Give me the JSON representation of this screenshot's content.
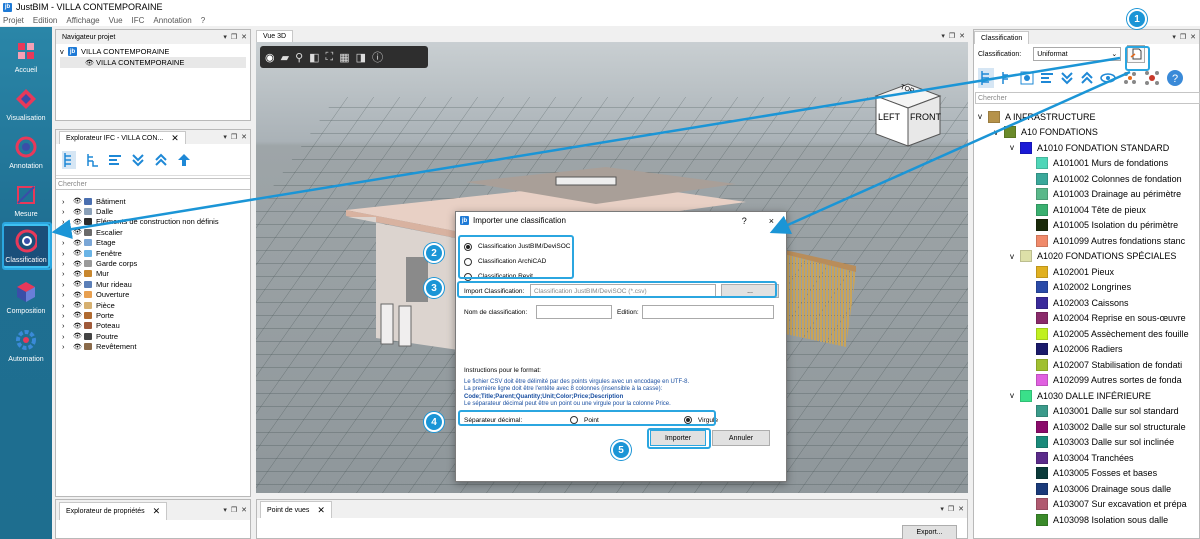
{
  "app": {
    "title": "JustBIM - VILLA CONTEMPORAINE",
    "icon_label": "jb"
  },
  "menu": [
    "Projet",
    "Edition",
    "Affichage",
    "Vue",
    "IFC",
    "Annotation",
    "?"
  ],
  "rail": [
    {
      "label": "Accueil",
      "icon": "home-icon"
    },
    {
      "label": "Visualisation",
      "icon": "visualisation-icon"
    },
    {
      "label": "Annotation",
      "icon": "annotation-icon"
    },
    {
      "label": "Mesure",
      "icon": "measure-icon"
    },
    {
      "label": "Classification",
      "icon": "classification-icon",
      "active": true
    },
    {
      "label": "Composition",
      "icon": "composition-icon"
    },
    {
      "label": "Automation",
      "icon": "automation-icon"
    }
  ],
  "project_nav": {
    "tab": "Navigateur projet",
    "root": "VILLA CONTEMPORAINE",
    "child": "VILLA CONTEMPORAINE"
  },
  "ifc_explorer": {
    "tab": "Explorateur IFC - VILLA CON...",
    "search_placeholder": "Chercher",
    "items": [
      {
        "label": "Bâtiment",
        "color": "#4a6fb0"
      },
      {
        "label": "Dalle",
        "color": "#8aa0b8"
      },
      {
        "label": "Eléments de construction non définis",
        "color": "#2d2d2d"
      },
      {
        "label": "Escalier",
        "color": "#6a6a6a"
      },
      {
        "label": "Etage",
        "color": "#7aa6d6"
      },
      {
        "label": "Fenêtre",
        "color": "#6ab4e6"
      },
      {
        "label": "Garde corps",
        "color": "#9a9a9a"
      },
      {
        "label": "Mur",
        "color": "#c8872e"
      },
      {
        "label": "Mur rideau",
        "color": "#5b7fb8"
      },
      {
        "label": "Ouverture",
        "color": "#e8a050"
      },
      {
        "label": "Pièce",
        "color": "#d6b070"
      },
      {
        "label": "Porte",
        "color": "#b06a30"
      },
      {
        "label": "Poteau",
        "color": "#a05a3a"
      },
      {
        "label": "Poutre",
        "color": "#444444"
      },
      {
        "label": "Revêtement",
        "color": "#8a6a4a"
      }
    ]
  },
  "properties": {
    "tab": "Explorateur de propriétés"
  },
  "view3d": {
    "tab": "Vue 3D",
    "cube": {
      "top": "TOP",
      "left": "LEFT",
      "front": "FRONT"
    }
  },
  "viewpoints": {
    "tab": "Point de vues",
    "export_label": "Export..."
  },
  "classification": {
    "tab": "Classification",
    "label": "Classification:",
    "selected": "Uniformat",
    "search_placeholder": "Chercher",
    "rows": [
      {
        "code": "A INFRASTRUCTURE",
        "level": 0,
        "color": "#b5924a",
        "expander": "v"
      },
      {
        "code": "A10 FONDATIONS",
        "level": 1,
        "color": "#6a8a2a",
        "expander": "v"
      },
      {
        "code": "A1010 FONDATION STANDARD",
        "level": 2,
        "color": "#1a1ad6",
        "expander": "v"
      },
      {
        "code": "A101001 Murs de fondations",
        "level": 3,
        "color": "#4fd6b8"
      },
      {
        "code": "A101002 Colonnes de fondation",
        "level": 3,
        "color": "#3aa89a"
      },
      {
        "code": "A101003 Drainage au périmètre",
        "level": 3,
        "color": "#5ab88a"
      },
      {
        "code": "A101004 Tête de pieux",
        "level": 3,
        "color": "#3ab070"
      },
      {
        "code": "A101005 Isolation du périmètre",
        "level": 3,
        "color": "#1a2a0a"
      },
      {
        "code": "A101099 Autres fondations stanc",
        "level": 3,
        "color": "#f08a6a"
      },
      {
        "code": "A1020 FONDATIONS SPÉCIALES",
        "level": 2,
        "color": "#dde0a8",
        "expander": "v"
      },
      {
        "code": "A102001 Pieux",
        "level": 3,
        "color": "#e0b020"
      },
      {
        "code": "A102002 Longrines",
        "level": 3,
        "color": "#2a4aa8"
      },
      {
        "code": "A102003 Caissons",
        "level": 3,
        "color": "#3a2a9a"
      },
      {
        "code": "A102004 Reprise en sous-œuvre",
        "level": 3,
        "color": "#8a2a6a"
      },
      {
        "code": "A102005 Assèchement des fouille",
        "level": 3,
        "color": "#c0f020"
      },
      {
        "code": "A102006 Radiers",
        "level": 3,
        "color": "#1a1a6a"
      },
      {
        "code": "A102007 Stabilisation de fondati",
        "level": 3,
        "color": "#a0c030"
      },
      {
        "code": "A102099 Autres sortes de fonda",
        "level": 3,
        "color": "#e060e0"
      },
      {
        "code": "A1030 DALLE INFÉRIEURE",
        "level": 2,
        "color": "#3ae08a",
        "expander": "v"
      },
      {
        "code": "A103001 Dalle sur sol standard",
        "level": 3,
        "color": "#3a9a8a"
      },
      {
        "code": "A103002 Dalle sur sol structurale",
        "level": 3,
        "color": "#8a0a6a"
      },
      {
        "code": "A103003 Dalle sur sol inclinée",
        "level": 3,
        "color": "#1a8a7a"
      },
      {
        "code": "A103004 Tranchées",
        "level": 3,
        "color": "#5a2a8a"
      },
      {
        "code": "A103005 Fosses et bases",
        "level": 3,
        "color": "#0a3a3a"
      },
      {
        "code": "A103006 Drainage sous dalle",
        "level": 3,
        "color": "#1a3a7a"
      },
      {
        "code": "A103007 Sur excavation et prépa",
        "level": 3,
        "color": "#b05a70"
      },
      {
        "code": "A103098 Isolation sous dalle",
        "level": 3,
        "color": "#3a8a2a"
      }
    ]
  },
  "dialog": {
    "title": "Importer une classification",
    "help": "?",
    "close": "×",
    "options": [
      "Classification JustBIM/DeviSOC",
      "Classification ArchiCAD",
      "Classification Revit"
    ],
    "selected_option": 0,
    "import_label": "Import Classification:",
    "import_placeholder": "Classification JustBIM/DeviSOC (*.csv)",
    "browse_label": "...",
    "name_label": "Nom de classification:",
    "edition_label": "Edition:",
    "instructions_title": "Instructions pour le format:",
    "instructions_1": "Le fichier CSV doit être délimité par des points virgules avec un encodage en UTF-8.",
    "instructions_2": "La première ligne doit être l'entête avec 8 colonnes (insensible à la casse):",
    "instructions_3": "Code;Title;Parent;Quantity;Unit;Color;Price;Description",
    "instructions_4": "Le séparateur décimal peut être un point ou une virgule pour la colonne Price.",
    "separator_label": "Séparateur décimal:",
    "sep_point": "Point",
    "sep_virgule": "Virgule",
    "import_button": "Importer",
    "cancel_button": "Annuler"
  },
  "callouts": [
    "1",
    "2",
    "3",
    "4",
    "5"
  ],
  "colors": {
    "accent": "#1b95d6",
    "rail": "#2a7fa3"
  }
}
